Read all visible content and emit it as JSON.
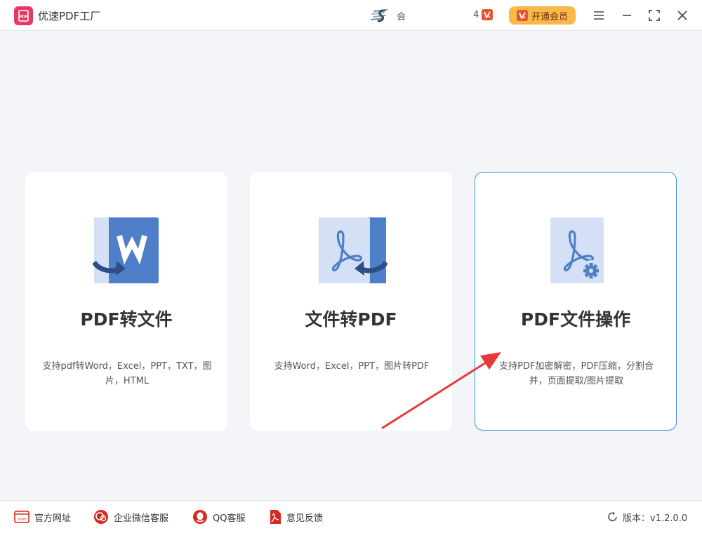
{
  "app": {
    "title": "优速PDF工厂",
    "logo_text": "PDF"
  },
  "header": {
    "user_name": "会",
    "vip_count": "4",
    "vip_button_label": "开通会员",
    "window_buttons": [
      "menu-icon",
      "minimize-icon",
      "maximize-icon",
      "close-icon"
    ]
  },
  "cards": [
    {
      "title": "PDF转文件",
      "description": "支持pdf转Word，Excel，PPT，TXT，图片，HTML",
      "icon": "pdf-to-word-icon"
    },
    {
      "title": "文件转PDF",
      "description": "支持Word，Excel，PPT，图片转PDF",
      "icon": "file-to-pdf-icon"
    },
    {
      "title": "PDF文件操作",
      "description": "支持PDF加密解密，PDF压缩，分割合并，页面提取/图片提取",
      "icon": "pdf-operations-icon",
      "selected": true
    }
  ],
  "footer": {
    "links": [
      {
        "label": "官方网址",
        "icon": "website-icon"
      },
      {
        "label": "企业微信客服",
        "icon": "wechat-icon"
      },
      {
        "label": "QQ客服",
        "icon": "qq-icon"
      },
      {
        "label": "意见反馈",
        "icon": "feedback-icon"
      }
    ],
    "version": "版本：v1.2.0.0"
  },
  "colors": {
    "accent": "#3a8fe0",
    "brand": "#e8386a",
    "vip": "#f9b84a",
    "icon_blue": "#4f7fc8",
    "icon_light": "#d4e0f5",
    "annotation_arrow": "#e8393a",
    "footer_icon": "#d9281f"
  }
}
